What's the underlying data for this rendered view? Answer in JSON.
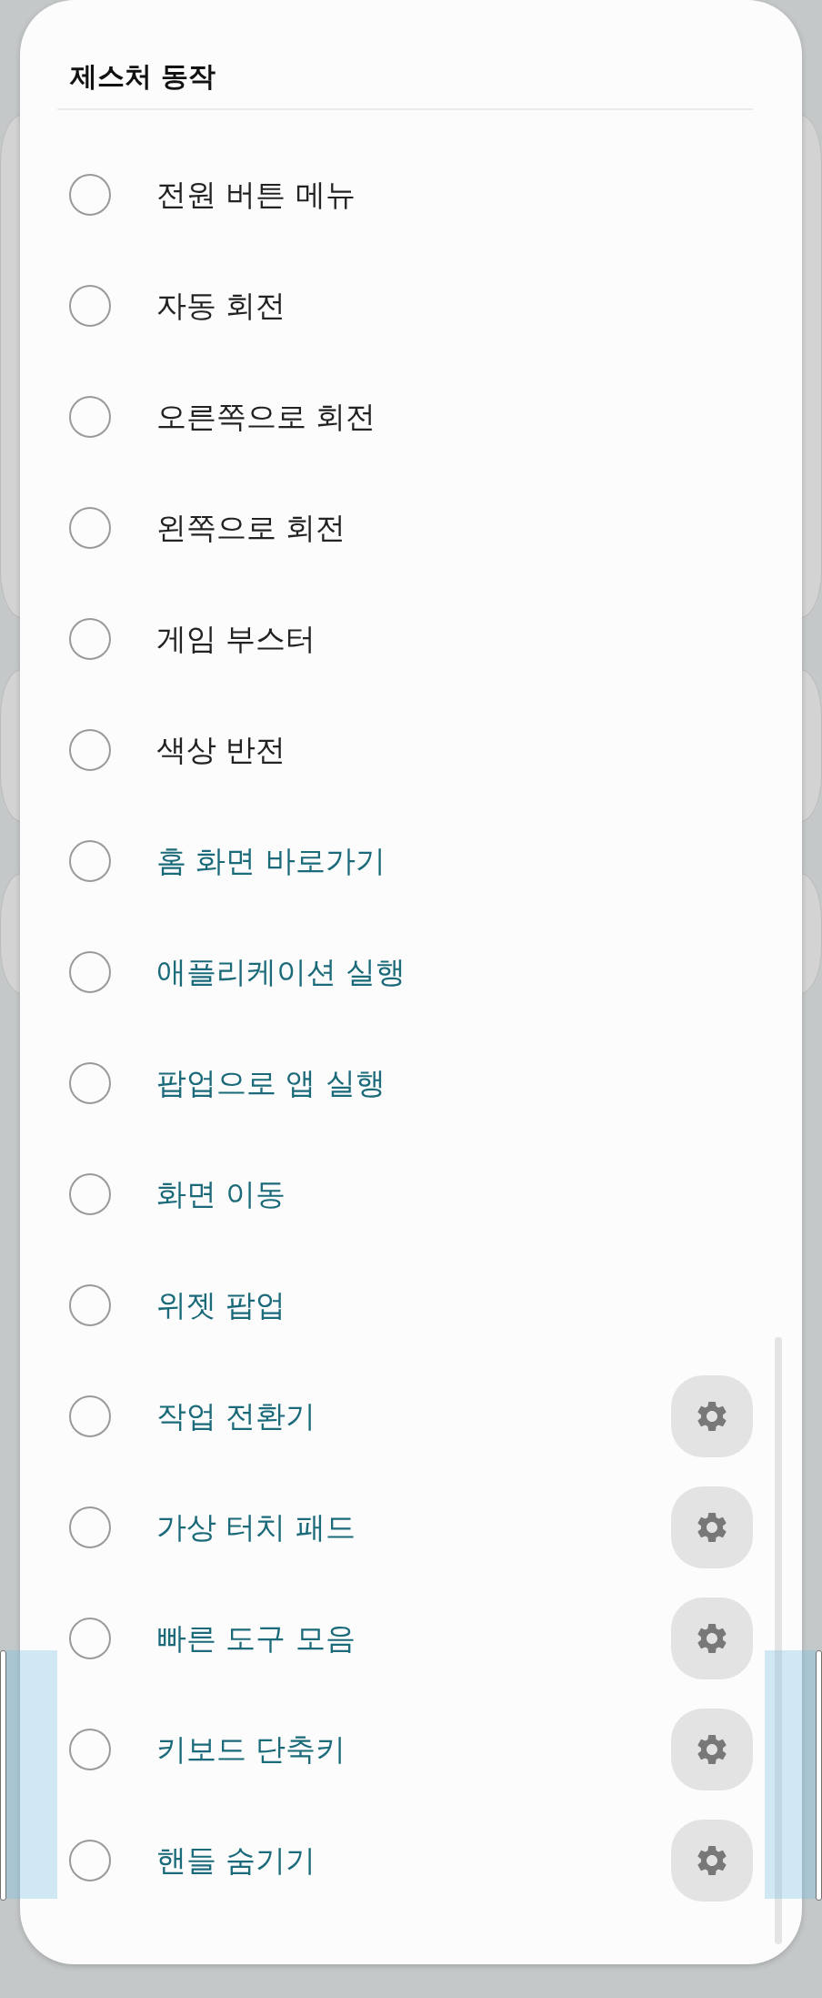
{
  "dialog": {
    "title": "제스처 동작"
  },
  "items": [
    {
      "label": "전원 버튼 메뉴",
      "color": "#222222",
      "selected": false,
      "settings_button": false
    },
    {
      "label": "자동 회전",
      "color": "#222222",
      "selected": false,
      "settings_button": false
    },
    {
      "label": "오른쪽으로 회전",
      "color": "#222222",
      "selected": false,
      "settings_button": false
    },
    {
      "label": "왼쪽으로 회전",
      "color": "#222222",
      "selected": false,
      "settings_button": false
    },
    {
      "label": "게임 부스터",
      "color": "#222222",
      "selected": false,
      "settings_button": false
    },
    {
      "label": "색상 반전",
      "color": "#222222",
      "selected": false,
      "settings_button": false
    },
    {
      "label": "홈 화면 바로가기",
      "color": "#1b6a7a",
      "selected": false,
      "settings_button": false
    },
    {
      "label": "애플리케이션 실행",
      "color": "#1b6a7a",
      "selected": false,
      "settings_button": false
    },
    {
      "label": "팝업으로 앱 실행",
      "color": "#1b6a7a",
      "selected": false,
      "settings_button": false
    },
    {
      "label": "화면 이동",
      "color": "#1b6a7a",
      "selected": false,
      "settings_button": false
    },
    {
      "label": "위젯 팝업",
      "color": "#1b6a7a",
      "selected": false,
      "settings_button": false
    },
    {
      "label": "작업 전환기",
      "color": "#1b6a7a",
      "selected": false,
      "settings_button": true
    },
    {
      "label": "가상 터치 패드",
      "color": "#1b6a7a",
      "selected": false,
      "settings_button": true
    },
    {
      "label": "빠른 도구 모음",
      "color": "#1b6a7a",
      "selected": false,
      "settings_button": true
    },
    {
      "label": "키보드 단축키",
      "color": "#1b6a7a",
      "selected": false,
      "settings_button": true
    },
    {
      "label": "핸들 숨기기",
      "color": "#1b6a7a",
      "selected": false,
      "settings_button": true
    }
  ]
}
